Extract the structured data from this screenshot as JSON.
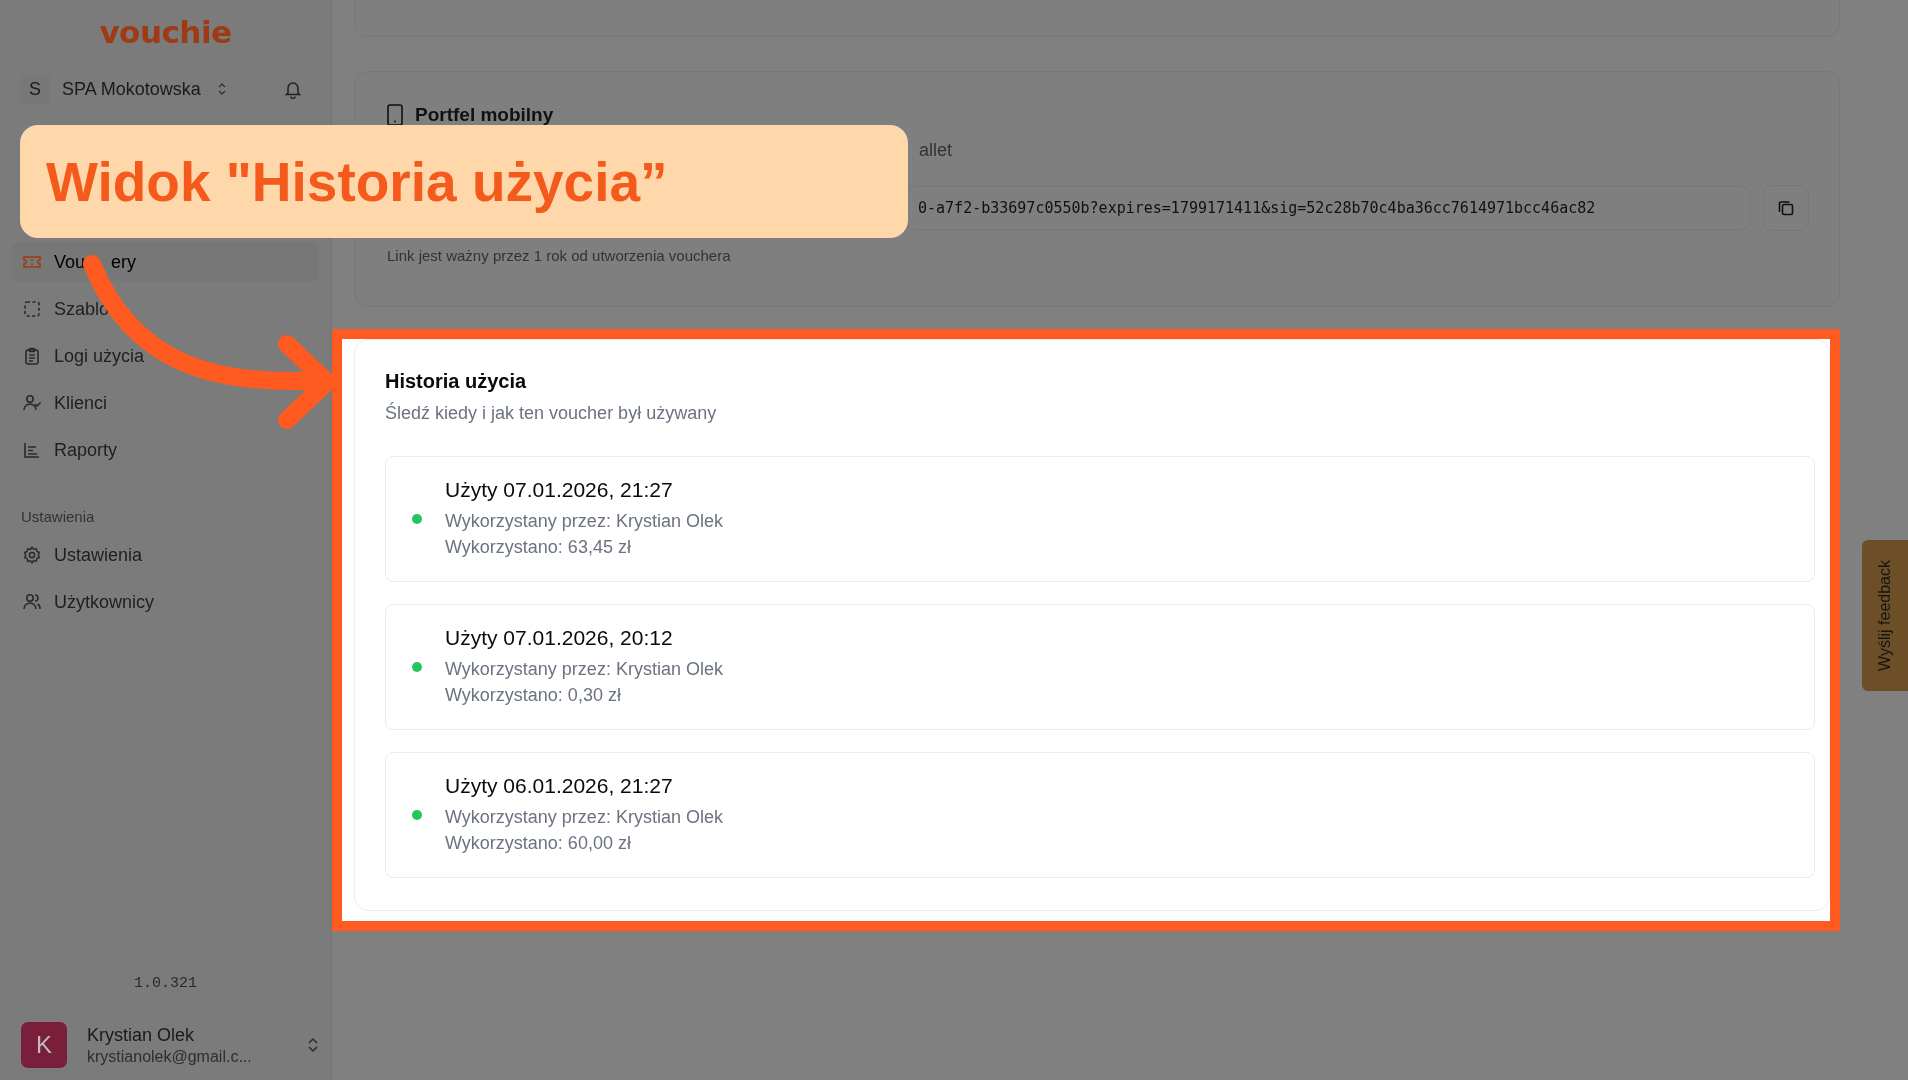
{
  "sidebar": {
    "logo": "vouchie",
    "workspace": {
      "initial": "S",
      "name": "SPA Mokotowska"
    },
    "items": [
      {
        "label": "Vou",
        "label_tail": "ery",
        "selected": true
      },
      {
        "label": "Szablo",
        "selected": false
      },
      {
        "label": "Logi użycia",
        "selected": false
      },
      {
        "label": "Klienci",
        "selected": false
      },
      {
        "label": "Raporty",
        "selected": false
      }
    ],
    "settings_section": {
      "title": "Ustawienia",
      "items": [
        {
          "label": "Ustawienia",
          "selected": false
        },
        {
          "label": "Użytkownicy",
          "selected": false
        }
      ]
    },
    "version": "1.0.321",
    "user": {
      "initial": "K",
      "name": "Krystian Olek",
      "email": "krystianolek@gmail.c..."
    }
  },
  "mobile_wallet": {
    "title": "Portfel mobilny",
    "description": "allet",
    "link": "0-a7f2-b33697c0550b?expires=1799171411&sig=52c28b70c4ba36cc7614971bcc46ac82",
    "note": "Link jest ważny przez 1 rok od utworzenia vouchera"
  },
  "history": {
    "title": "Historia użycia",
    "subtitle": "Śledź kiedy i jak ten voucher był używany",
    "entries": [
      {
        "title": "Użyty 07.01.2026, 21:27",
        "used_by": "Wykorzystany przez: Krystian Olek",
        "amount": "Wykorzystano: 63,45 zł"
      },
      {
        "title": "Użyty 07.01.2026, 20:12",
        "used_by": "Wykorzystany przez: Krystian Olek",
        "amount": "Wykorzystano: 0,30 zł"
      },
      {
        "title": "Użyty 06.01.2026, 21:27",
        "used_by": "Wykorzystany przez: Krystian Olek",
        "amount": "Wykorzystano: 60,00 zł"
      }
    ]
  },
  "callout": {
    "text": "Widok \"Historia użycia”"
  },
  "feedback": {
    "label": "Wyślij feedback"
  }
}
